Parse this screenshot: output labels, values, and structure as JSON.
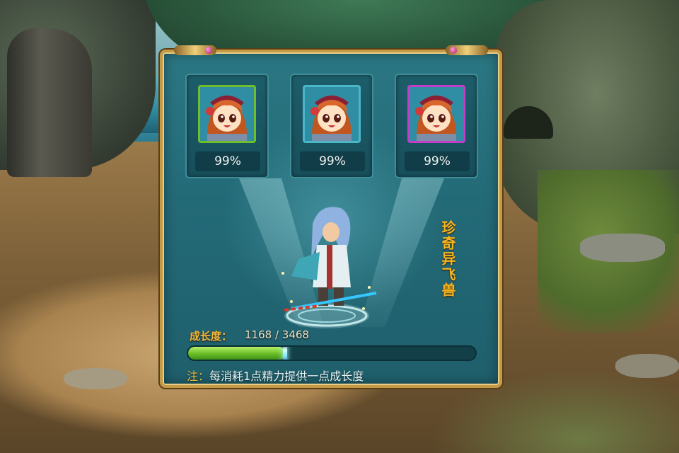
{
  "slots": [
    {
      "percent": "99%",
      "frame_color": "#6fbf2c",
      "icon": "character-portrait-icon"
    },
    {
      "percent": "99%",
      "frame_color": "#4ab6c8",
      "icon": "character-portrait-icon"
    },
    {
      "percent": "99%",
      "frame_color": "#c23ec9",
      "icon": "character-portrait-icon"
    }
  ],
  "title_vertical": "珍奇异飞兽",
  "growth": {
    "label": "成长度：",
    "value_text": "1168 / 3468",
    "current": 1168,
    "max": 3468,
    "fill_color": "#6fc22a"
  },
  "note": {
    "prefix": "注：",
    "text": "每消耗1点精力提供一点成长度"
  }
}
